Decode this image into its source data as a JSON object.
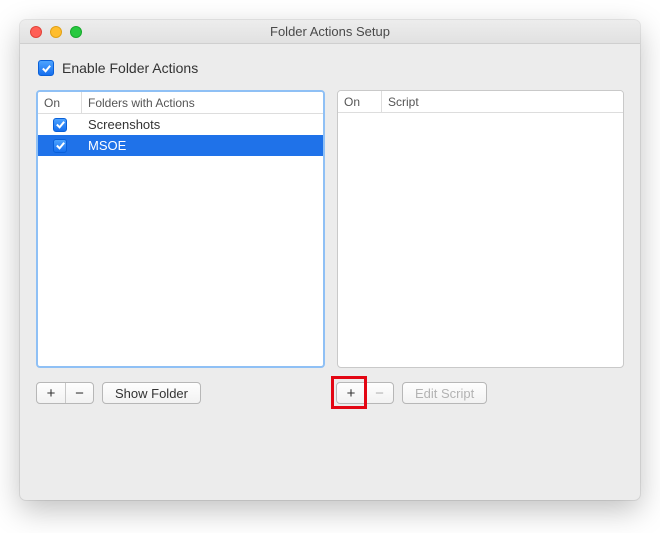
{
  "window": {
    "title": "Folder Actions Setup"
  },
  "enable": {
    "label": "Enable Folder Actions",
    "checked": true
  },
  "leftPane": {
    "headers": {
      "on": "On",
      "rest": "Folders with Actions"
    },
    "rows": [
      {
        "on": true,
        "label": "Screenshots",
        "selected": false
      },
      {
        "on": true,
        "label": "MSOE",
        "selected": true
      }
    ]
  },
  "rightPane": {
    "headers": {
      "on": "On",
      "rest": "Script"
    },
    "rows": []
  },
  "buttons": {
    "plus": "+",
    "minus": "−",
    "showFolder": "Show Folder",
    "editScript": "Edit Script"
  }
}
